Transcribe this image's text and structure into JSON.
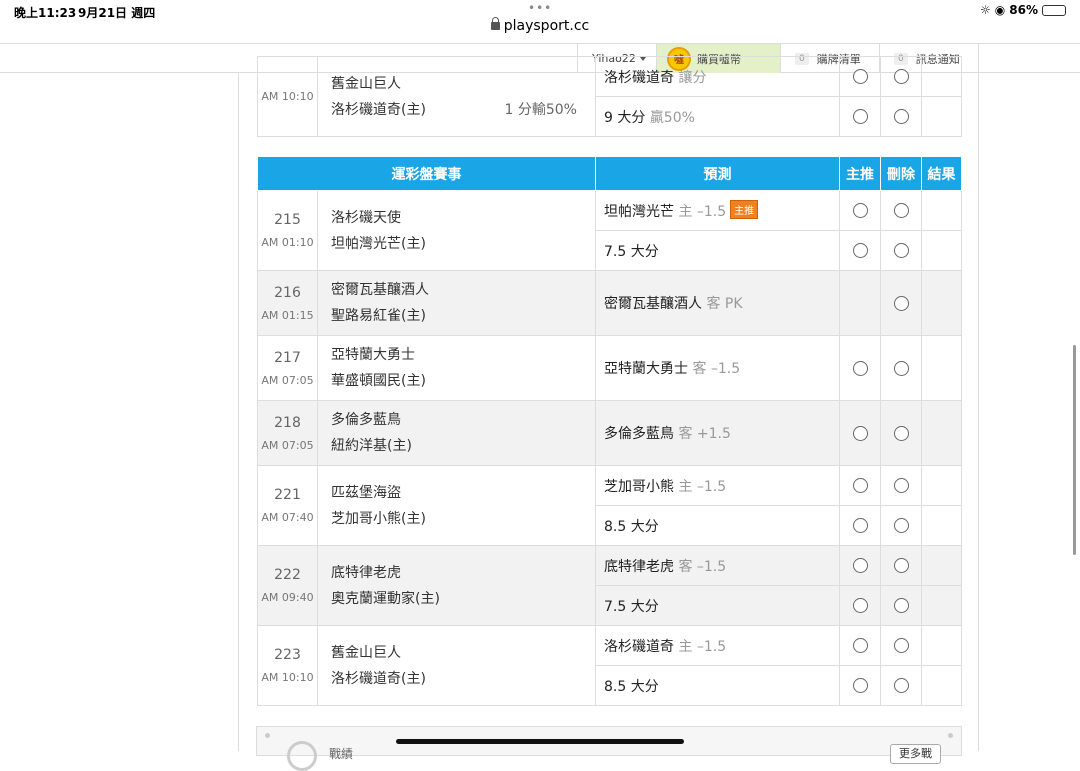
{
  "status_bar": {
    "time": "晚上11:23",
    "date": "9月21日 週四",
    "battery": "86%",
    "battery_level": 0.86
  },
  "url": "playsport.cc",
  "nav": {
    "user": "Yihao22",
    "coin_icon_text": "噓",
    "buy_coins": "購買噓幣",
    "cart_count": "0",
    "cart": "購牌清單",
    "msg_count": "0",
    "messages": "訊息通知"
  },
  "top_block": {
    "time": "AM 10:10",
    "away": "舊金山巨人",
    "home": "洛杉磯道奇(主)",
    "line": "1 分輸50%",
    "pred1_team": "洛杉磯道奇",
    "pred1_sub": "讓分",
    "pred2_main": "9 大分",
    "pred2_sub": "贏50%"
  },
  "table": {
    "headers": {
      "game": "運彩盤賽事",
      "pred": "預測",
      "main": "主推",
      "del": "刪除",
      "result": "結果"
    },
    "badge_text": "主推",
    "rows": [
      {
        "id": "215",
        "time": "AM 01:10",
        "away": "洛杉磯天使",
        "home": "坦帕灣光芒(主)",
        "preds": [
          {
            "team": "坦帕灣光芒",
            "sub": "主 –1.5",
            "badge": true,
            "main_radio": true
          },
          {
            "team": "7.5 大分",
            "sub": "",
            "main_radio": true
          }
        ]
      },
      {
        "id": "216",
        "time": "AM 01:15",
        "away": "密爾瓦基釀酒人",
        "home": "聖路易紅雀(主)",
        "preds": [
          {
            "team": "密爾瓦基釀酒人",
            "sub": "客 PK",
            "main_radio": false
          }
        ]
      },
      {
        "id": "217",
        "time": "AM 07:05",
        "away": "亞特蘭大勇士",
        "home": "華盛頓國民(主)",
        "preds": [
          {
            "team": "亞特蘭大勇士",
            "sub": "客 –1.5",
            "main_radio": true
          }
        ]
      },
      {
        "id": "218",
        "time": "AM 07:05",
        "away": "多倫多藍鳥",
        "home": "紐約洋基(主)",
        "preds": [
          {
            "team": "多倫多藍鳥",
            "sub": "客 +1.5",
            "main_radio": true
          }
        ]
      },
      {
        "id": "221",
        "time": "AM 07:40",
        "away": "匹茲堡海盜",
        "home": "芝加哥小熊(主)",
        "preds": [
          {
            "team": "芝加哥小熊",
            "sub": "主 –1.5",
            "main_radio": true
          },
          {
            "team": "8.5 大分",
            "sub": "",
            "main_radio": true
          }
        ]
      },
      {
        "id": "222",
        "time": "AM 09:40",
        "away": "底特律老虎",
        "home": "奧克蘭運動家(主)",
        "preds": [
          {
            "team": "底特律老虎",
            "sub": "客 –1.5",
            "main_radio": true
          },
          {
            "team": "7.5 大分",
            "sub": "",
            "main_radio": true
          }
        ]
      },
      {
        "id": "223",
        "time": "AM 10:10",
        "away": "舊金山巨人",
        "home": "洛杉磯道奇(主)",
        "preds": [
          {
            "team": "洛杉磯道奇",
            "sub": "主 –1.5",
            "main_radio": true
          },
          {
            "team": "8.5 大分",
            "sub": "",
            "main_radio": true
          }
        ]
      }
    ]
  },
  "bottom": {
    "label": "戰績",
    "button": "更多戰"
  }
}
